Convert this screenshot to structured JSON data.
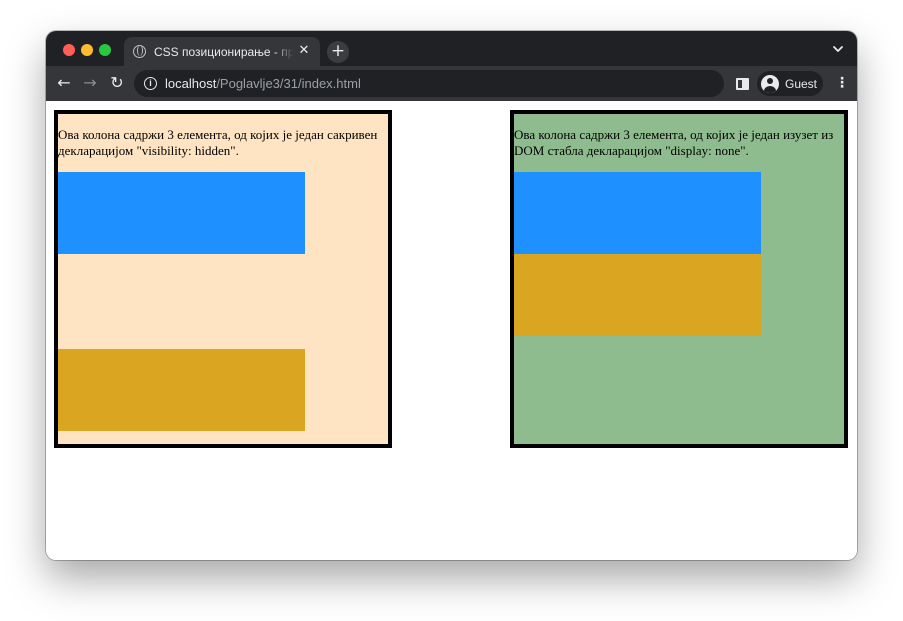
{
  "browser": {
    "tab": {
      "title": "CSS позиционирање - приказ",
      "close_glyph": "✕"
    },
    "new_tab_glyph": "+",
    "tab_menu_icon": "chevron-down-icon",
    "nav": {
      "back_glyph": "←",
      "forward_glyph": "→",
      "reload_glyph": "↻"
    },
    "address": {
      "info_glyph": "i",
      "host": "localhost",
      "path": "/Poglavlje3/31/index.html"
    },
    "profile": {
      "name": "Guest"
    },
    "menu_glyph": "⋮"
  },
  "page": {
    "left_column": {
      "text": "Ова колона садржи 3 елемента, од којих је један сакривен декларацијом \"visibility: hidden\".",
      "background": "#ffe4c4"
    },
    "right_column": {
      "text": "Ова колона садржи 3 елемента, од којих је један изузет из DOM стабла декларацијом \"display: none\".",
      "background": "#8fbc8f"
    },
    "colors": {
      "blue_box": "#1e90ff",
      "gold_box": "#daa520",
      "border": "#000000"
    }
  }
}
